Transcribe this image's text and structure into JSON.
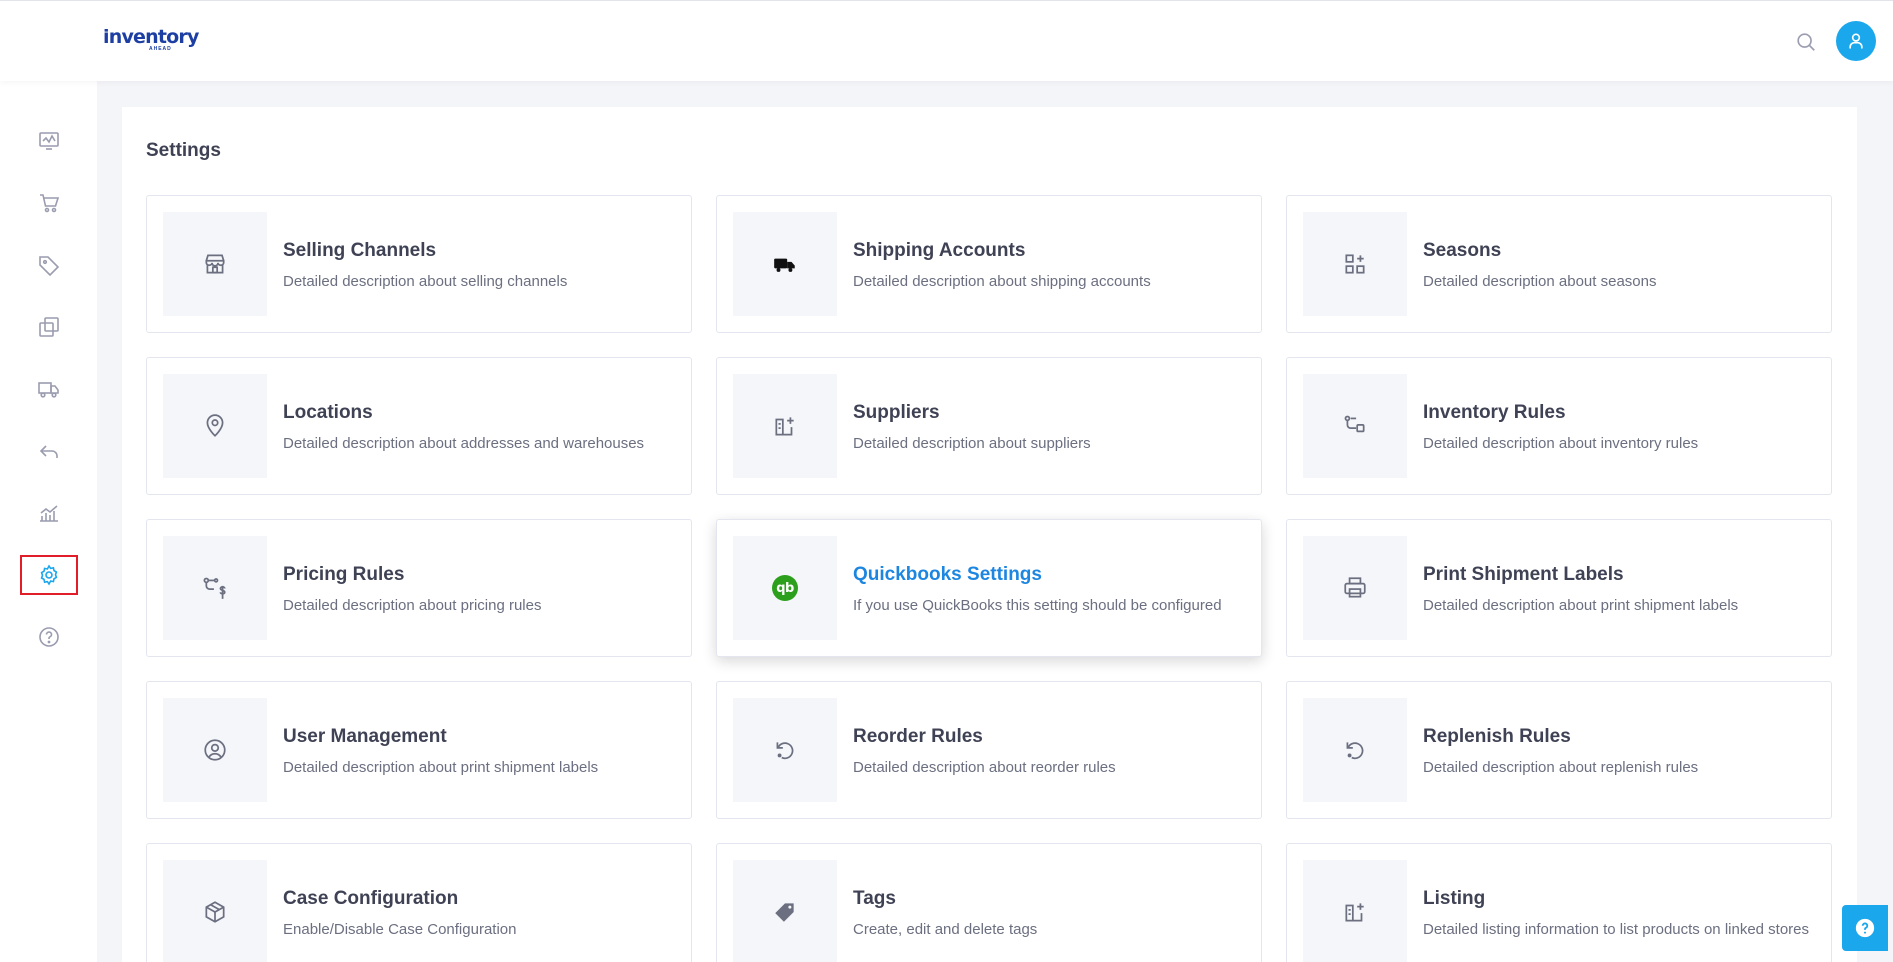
{
  "header": {
    "logo_text": "inventory",
    "logo_sub": "AHEAD",
    "search_icon": "search-icon",
    "avatar_icon": "user-icon"
  },
  "sidebar": {
    "items": [
      {
        "icon": "dashboard-monitor-icon"
      },
      {
        "icon": "cart-icon"
      },
      {
        "icon": "tag-icon"
      },
      {
        "icon": "products-copy-icon"
      },
      {
        "icon": "truck-icon"
      },
      {
        "icon": "return-arrow-icon"
      },
      {
        "icon": "analytics-chart-icon"
      },
      {
        "icon": "gear-icon",
        "active": true
      },
      {
        "icon": "help-circle-icon"
      }
    ]
  },
  "main": {
    "title": "Settings",
    "cards": [
      {
        "title": "Selling Channels",
        "desc": "Detailed description about selling channels",
        "icon": "store-icon"
      },
      {
        "title": "Shipping Accounts",
        "desc": "Detailed description about shipping accounts",
        "icon": "truck-icon"
      },
      {
        "title": "Seasons",
        "desc": "Detailed description about seasons",
        "icon": "grid-plus-icon"
      },
      {
        "title": "Locations",
        "desc": "Detailed description about addresses and warehouses",
        "icon": "map-pin-icon"
      },
      {
        "title": "Suppliers",
        "desc": "Detailed description about suppliers",
        "icon": "box-plus-icon"
      },
      {
        "title": "Inventory Rules",
        "desc": "Detailed description about inventory rules",
        "icon": "flow-icon"
      },
      {
        "title": "Pricing Rules",
        "desc": "Detailed description about pricing rules",
        "icon": "flow-dollar-icon"
      },
      {
        "title": "Quickbooks Settings",
        "desc": "If you use QuickBooks this setting should be configured",
        "icon": "quickbooks-icon",
        "highlight": true,
        "badge": "qb"
      },
      {
        "title": "Print Shipment Labels",
        "desc": "Detailed description about print shipment labels",
        "icon": "printer-icon"
      },
      {
        "title": "User Management",
        "desc": "Detailed description about print shipment labels",
        "icon": "user-circle-icon"
      },
      {
        "title": "Reorder Rules",
        "desc": "Detailed description about reorder rules",
        "icon": "rotate-icon"
      },
      {
        "title": "Replenish Rules",
        "desc": "Detailed description about replenish rules",
        "icon": "rotate-icon"
      },
      {
        "title": "Case Configuration",
        "desc": "Enable/Disable Case Configuration",
        "icon": "package-icon"
      },
      {
        "title": "Tags",
        "desc": "Create, edit and delete tags",
        "icon": "tag-icon"
      },
      {
        "title": "Listing",
        "desc": "Detailed listing information to list products on linked stores",
        "icon": "box-plus-icon"
      }
    ]
  },
  "help_widget": {
    "icon": "question-icon"
  },
  "colors": {
    "accent": "#1aa7ec",
    "brand": "#1d3fa3",
    "active_border": "#e11d2a",
    "link_title": "#1d86e0",
    "quickbooks_green": "#2ca01c"
  }
}
